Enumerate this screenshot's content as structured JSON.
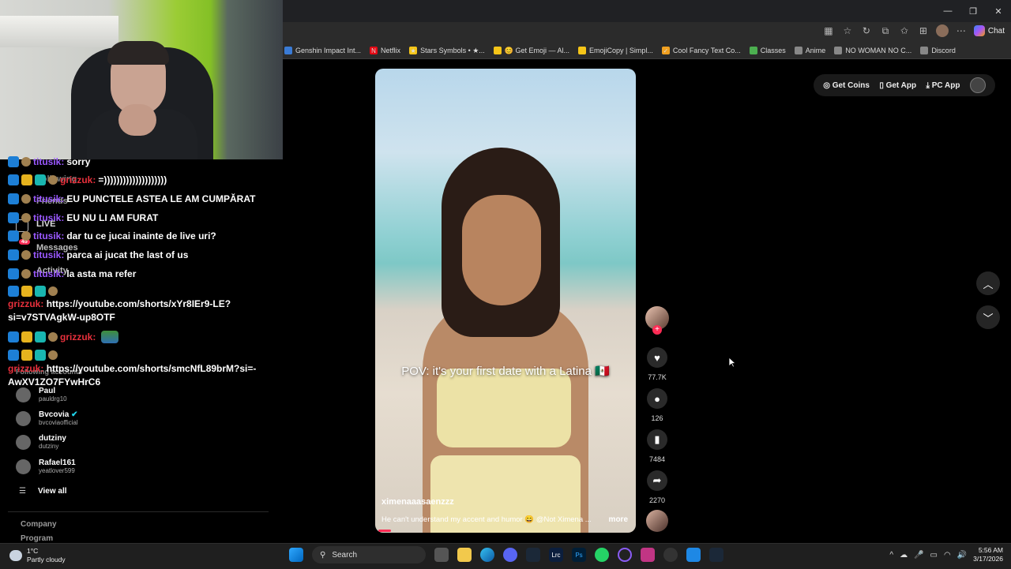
{
  "window": {
    "minimize_icon": "—",
    "maximize_icon": "❐",
    "close_icon": "✕"
  },
  "toolbar": {
    "chat_label": "Chat"
  },
  "bookmarks": [
    {
      "label": "Genshin Impact Int...",
      "color": "#3a7bd5",
      "icon": ""
    },
    {
      "label": "Netflix",
      "color": "#e50914",
      "icon": "N"
    },
    {
      "label": "Stars Symbols • ★...",
      "color": "#f5c518",
      "icon": "★"
    },
    {
      "label": "😊 Get Emoji — Al...",
      "color": "#f5c518",
      "icon": ""
    },
    {
      "label": "EmojiCopy | Simpl...",
      "color": "#f5c518",
      "icon": ""
    },
    {
      "label": "Cool Fancy Text Co...",
      "color": "#f0a020",
      "icon": "✓"
    },
    {
      "label": "Classes",
      "color": "#4caf50",
      "icon": ""
    },
    {
      "label": "Anime",
      "color": "#888888",
      "icon": ""
    },
    {
      "label": "NO WOMAN NO C...",
      "color": "#888888",
      "icon": ""
    },
    {
      "label": "Discord",
      "color": "#888888",
      "icon": ""
    }
  ],
  "nav": {
    "following": "Following",
    "friends": "Friends",
    "live": "LIVE",
    "messages": "Messages",
    "messages_badge": "45",
    "activity": "Activity",
    "following_accounts": "Following accounts"
  },
  "chat": [
    {
      "user": "titusik:",
      "text": "sorry",
      "badges": 2
    },
    {
      "user": "grizzuk:",
      "text": "=))))))))))))))))))))",
      "badges": 4,
      "red": true
    },
    {
      "user": "titusik:",
      "text": "EU PUNCTELE ASTEA LE AM CUMPĂRAT",
      "badges": 2
    },
    {
      "user": "titusik:",
      "text": "EU NU LI AM FURAT",
      "badges": 2
    },
    {
      "user": "titusik:",
      "text": "dar tu ce jucai inainte de live uri?",
      "badges": 2
    },
    {
      "user": "titusik:",
      "text": "parca ai jucat the last of us",
      "badges": 2
    },
    {
      "user": "titusik:",
      "text": "la asta ma refer",
      "badges": 2
    }
  ],
  "chat_wrapped": [
    {
      "user": "grizzuk:",
      "text": "https://youtube.com/shorts/xYr8IEr9-LE?si=v7STVAgkW-up8OTF"
    },
    {
      "user": "grizzuk:",
      "text": "",
      "emote": true
    },
    {
      "user": "grizzuk:",
      "text": "https://youtube.com/shorts/smcNfL89brM?si=-AwXV1ZO7FYwHrC6"
    }
  ],
  "following_accounts": [
    {
      "name": "Paul",
      "handle": "pauldrg10"
    },
    {
      "name": "Bvcovia",
      "handle": "bvcoviaofficial",
      "verified": true
    },
    {
      "name": "dutziny",
      "handle": "dutziny"
    },
    {
      "name": "Rafael161",
      "handle": "yeatlover599"
    }
  ],
  "view_all": "View all",
  "footer": {
    "company": "Company",
    "program": "Program"
  },
  "video": {
    "caption": "POV: it's your first date with a Latina 🇲🇽",
    "username": "ximenaaasaenzzz",
    "description": "He can't understand my accent and humor 😄 @Not Ximena ...",
    "more": "more"
  },
  "actions": {
    "likes": "77.7K",
    "comments": "126",
    "saves": "7484",
    "shares": "2270"
  },
  "topright": {
    "coins": "Get Coins",
    "app": "Get App",
    "pc_app": "PC App"
  },
  "taskbar": {
    "temp": "1°C",
    "weather": "Partly cloudy",
    "search": "Search",
    "time": "5:56 AM",
    "date": "3/17/2026"
  }
}
